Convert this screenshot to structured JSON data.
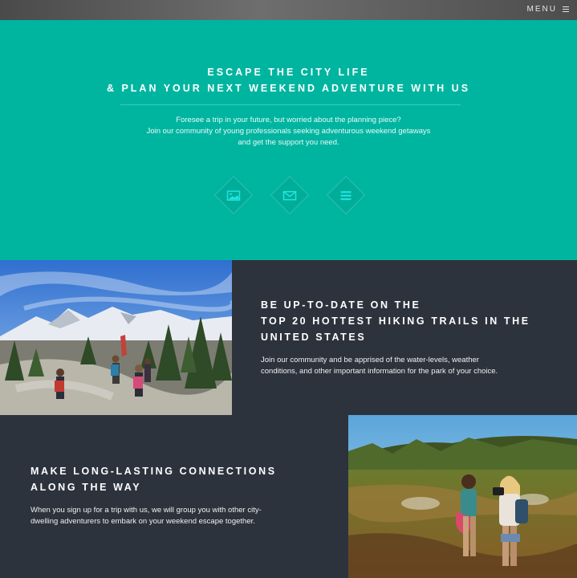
{
  "nav": {
    "menu_label": "MENU",
    "menu_icon": "hamburger-icon"
  },
  "hero": {
    "title_line1": "ESCAPE THE CITY LIFE",
    "title_line2": "& PLAN YOUR NEXT WEEKEND ADVENTURE WITH US",
    "text_line1": "Foresee a trip in your future, but worried about the planning piece?",
    "text_line2": "Join our community of young professionals seeking adventurous weekend getaways",
    "text_line3": "and get the support you need.",
    "icons": [
      "image-icon",
      "envelope-icon",
      "list-icon"
    ],
    "background_color": "#00b5a0",
    "icon_color": "#21e3df"
  },
  "section_trails": {
    "title_line1": "BE UP-TO-DATE ON THE",
    "title_line2": "TOP 20 HOTTEST HIKING TRAILS IN THE",
    "title_line3": "UNITED STATES",
    "text_line1": "Join our community and be apprised of the water-levels, weather",
    "text_line2": "conditions, and other important information for the park of your choice.",
    "photo": "hikers-mountain-photo"
  },
  "section_connections": {
    "title_line1": "MAKE LONG-LASTING CONNECTIONS",
    "title_line2": "ALONG THE WAY",
    "text_line1": "When you sign up for a trip with us, we will group you with other city-",
    "text_line2": "dwelling adventurers to embark on your weekend escape together.",
    "photo": "travelers-camera-photo"
  },
  "colors": {
    "dark_panel": "#2d333d",
    "teal": "#00b5a0"
  }
}
